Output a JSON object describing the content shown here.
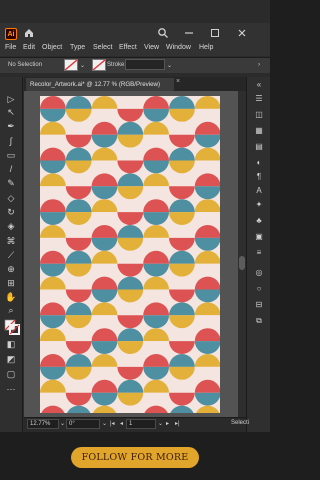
{
  "app": {
    "logo_text": "Ai",
    "menu": [
      "File",
      "Edit",
      "Object",
      "Type",
      "Select",
      "Effect",
      "View",
      "Window",
      "Help"
    ]
  },
  "control_bar": {
    "selection_label": "No Selection",
    "stroke_label": "Stroke:"
  },
  "document": {
    "tab_title": "Recolor_Artwork.ai* @ 12.77 % (RGB/Preview)",
    "close_glyph": "×"
  },
  "status_bar": {
    "zoom": "12.77%",
    "rotation": "0°",
    "artboard": "1",
    "tool": "Selecti"
  },
  "cta": {
    "label": "FOLLOW FOR MORE"
  },
  "pattern": {
    "colors": {
      "red": "#dd5353",
      "blue": "#4e8fa1",
      "yellow": "#e3b13a",
      "cream": "#f4e5e1"
    }
  },
  "colors": {
    "accent_orange": "#ff9a00",
    "cta_gold": "#e0a52a"
  }
}
